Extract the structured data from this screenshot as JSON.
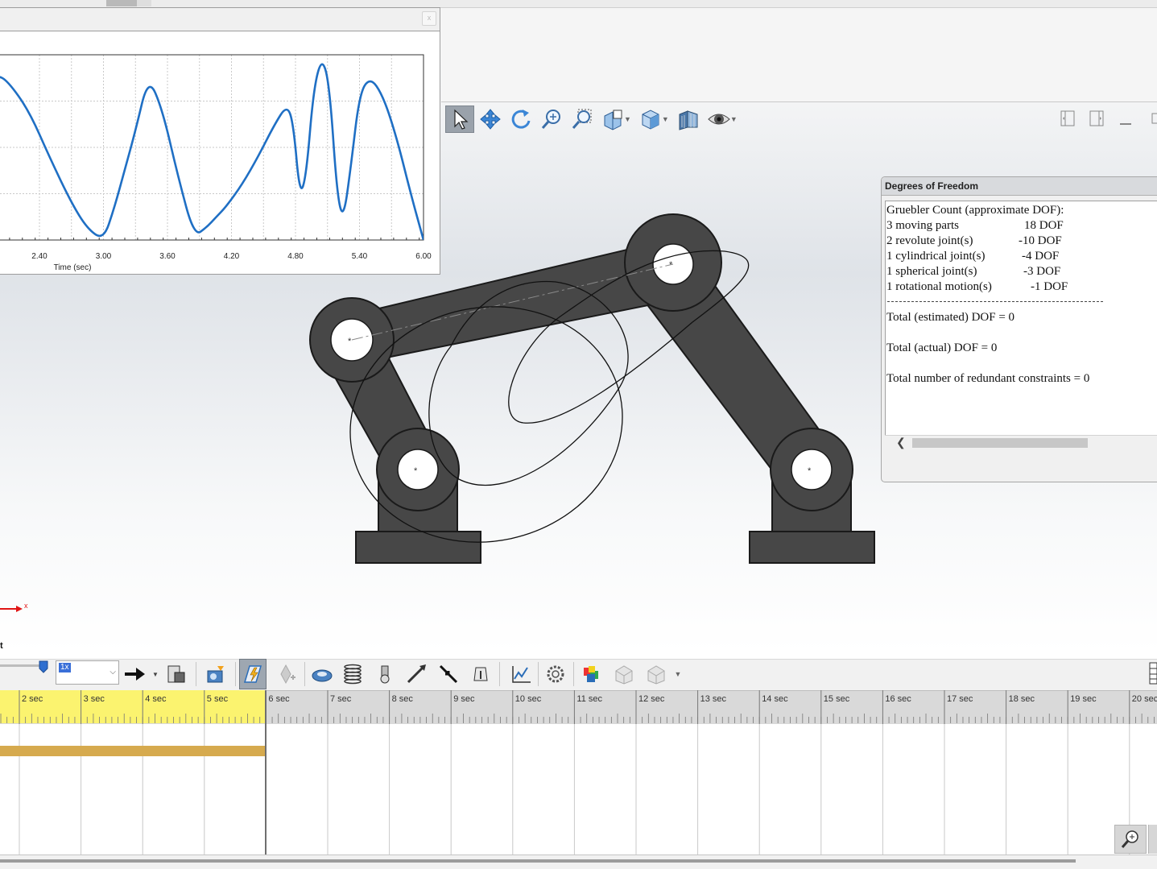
{
  "plot": {
    "x_label": "Time (sec)",
    "close_label": "x",
    "chart_data": {
      "type": "line",
      "title": "",
      "xlabel": "Time (sec)",
      "ylabel": "",
      "xlim": [
        2.0,
        6.0
      ],
      "ylim": [
        0,
        1
      ],
      "x_ticks": [
        "2.40",
        "3.00",
        "3.60",
        "4.20",
        "4.80",
        "5.40",
        "6.00"
      ],
      "grid": true,
      "series": [
        {
          "color": "#1f6fc4",
          "x": [
            1.8,
            2.0,
            2.1,
            2.3,
            2.5,
            2.7,
            2.85,
            3.0,
            3.1,
            3.2,
            3.3,
            3.42,
            3.55,
            3.7,
            3.85,
            3.97,
            4.05,
            4.15,
            4.3,
            4.45,
            4.6,
            4.72,
            4.78,
            4.84,
            4.9,
            4.97,
            5.05,
            5.12,
            5.19,
            5.25,
            5.32,
            5.4,
            5.5,
            5.62,
            5.75,
            5.88,
            6.0
          ],
          "y": [
            0.86,
            0.89,
            0.86,
            0.7,
            0.44,
            0.2,
            0.06,
            0.0,
            0.17,
            0.38,
            0.59,
            0.88,
            0.71,
            0.34,
            0.02,
            0.07,
            0.12,
            0.18,
            0.3,
            0.45,
            0.62,
            0.73,
            0.63,
            0.24,
            0.34,
            0.82,
            0.99,
            0.83,
            0.24,
            0.11,
            0.4,
            0.79,
            0.88,
            0.78,
            0.55,
            0.25,
            0.0
          ]
        }
      ]
    }
  },
  "hud": {
    "tools": [
      "select-icon",
      "pan-icon",
      "rotate-icon",
      "zoom-in-out-icon",
      "zoom-to-area-icon",
      "section-view-icon",
      "view-orientation-icon",
      "display-style-icon",
      "hide-show-icon"
    ]
  },
  "dof": {
    "title": "Degrees of Freedom",
    "header": "Gruebler Count (approximate DOF):",
    "rows": [
      {
        "label": "3 moving parts",
        "value": "18 DOF"
      },
      {
        "label": "2 revolute joint(s)",
        "value": "-10 DOF"
      },
      {
        "label": "1 cylindrical joint(s)",
        "value": "-4 DOF"
      },
      {
        "label": "1 spherical joint(s)",
        "value": "-3 DOF"
      },
      {
        "label": "1 rotational motion(s)",
        "value": "-1 DOF"
      }
    ],
    "estimated": "Total (estimated) DOF = 0",
    "actual": "Total (actual) DOF = 0",
    "redundant": "Total number of redundant constraints = 0"
  },
  "triad": {
    "x_label": "x",
    "bottom_label": "t"
  },
  "motion_toolbar": {
    "speed_value": "1x",
    "tools": [
      "play-arrow-icon",
      "save-animation-icon",
      "animation-wizard-icon",
      "autokey-icon",
      "add-key-icon",
      "motor-icon",
      "spring-icon",
      "damper-icon",
      "force-icon",
      "contact-icon",
      "gravity-icon",
      "results-plots-icon",
      "study-properties-icon",
      "motion-analysis-icon",
      "simulation-setup-icon",
      "export-icon"
    ]
  },
  "timeline": {
    "labels": [
      "2 sec",
      "3 sec",
      "4 sec",
      "5 sec",
      "6 sec",
      "7 sec",
      "8 sec",
      "9 sec",
      "10 sec",
      "11 sec",
      "12 sec",
      "13 sec",
      "14 sec",
      "15 sec",
      "16 sec",
      "17 sec",
      "18 sec",
      "19 sec",
      "20 sec"
    ]
  }
}
